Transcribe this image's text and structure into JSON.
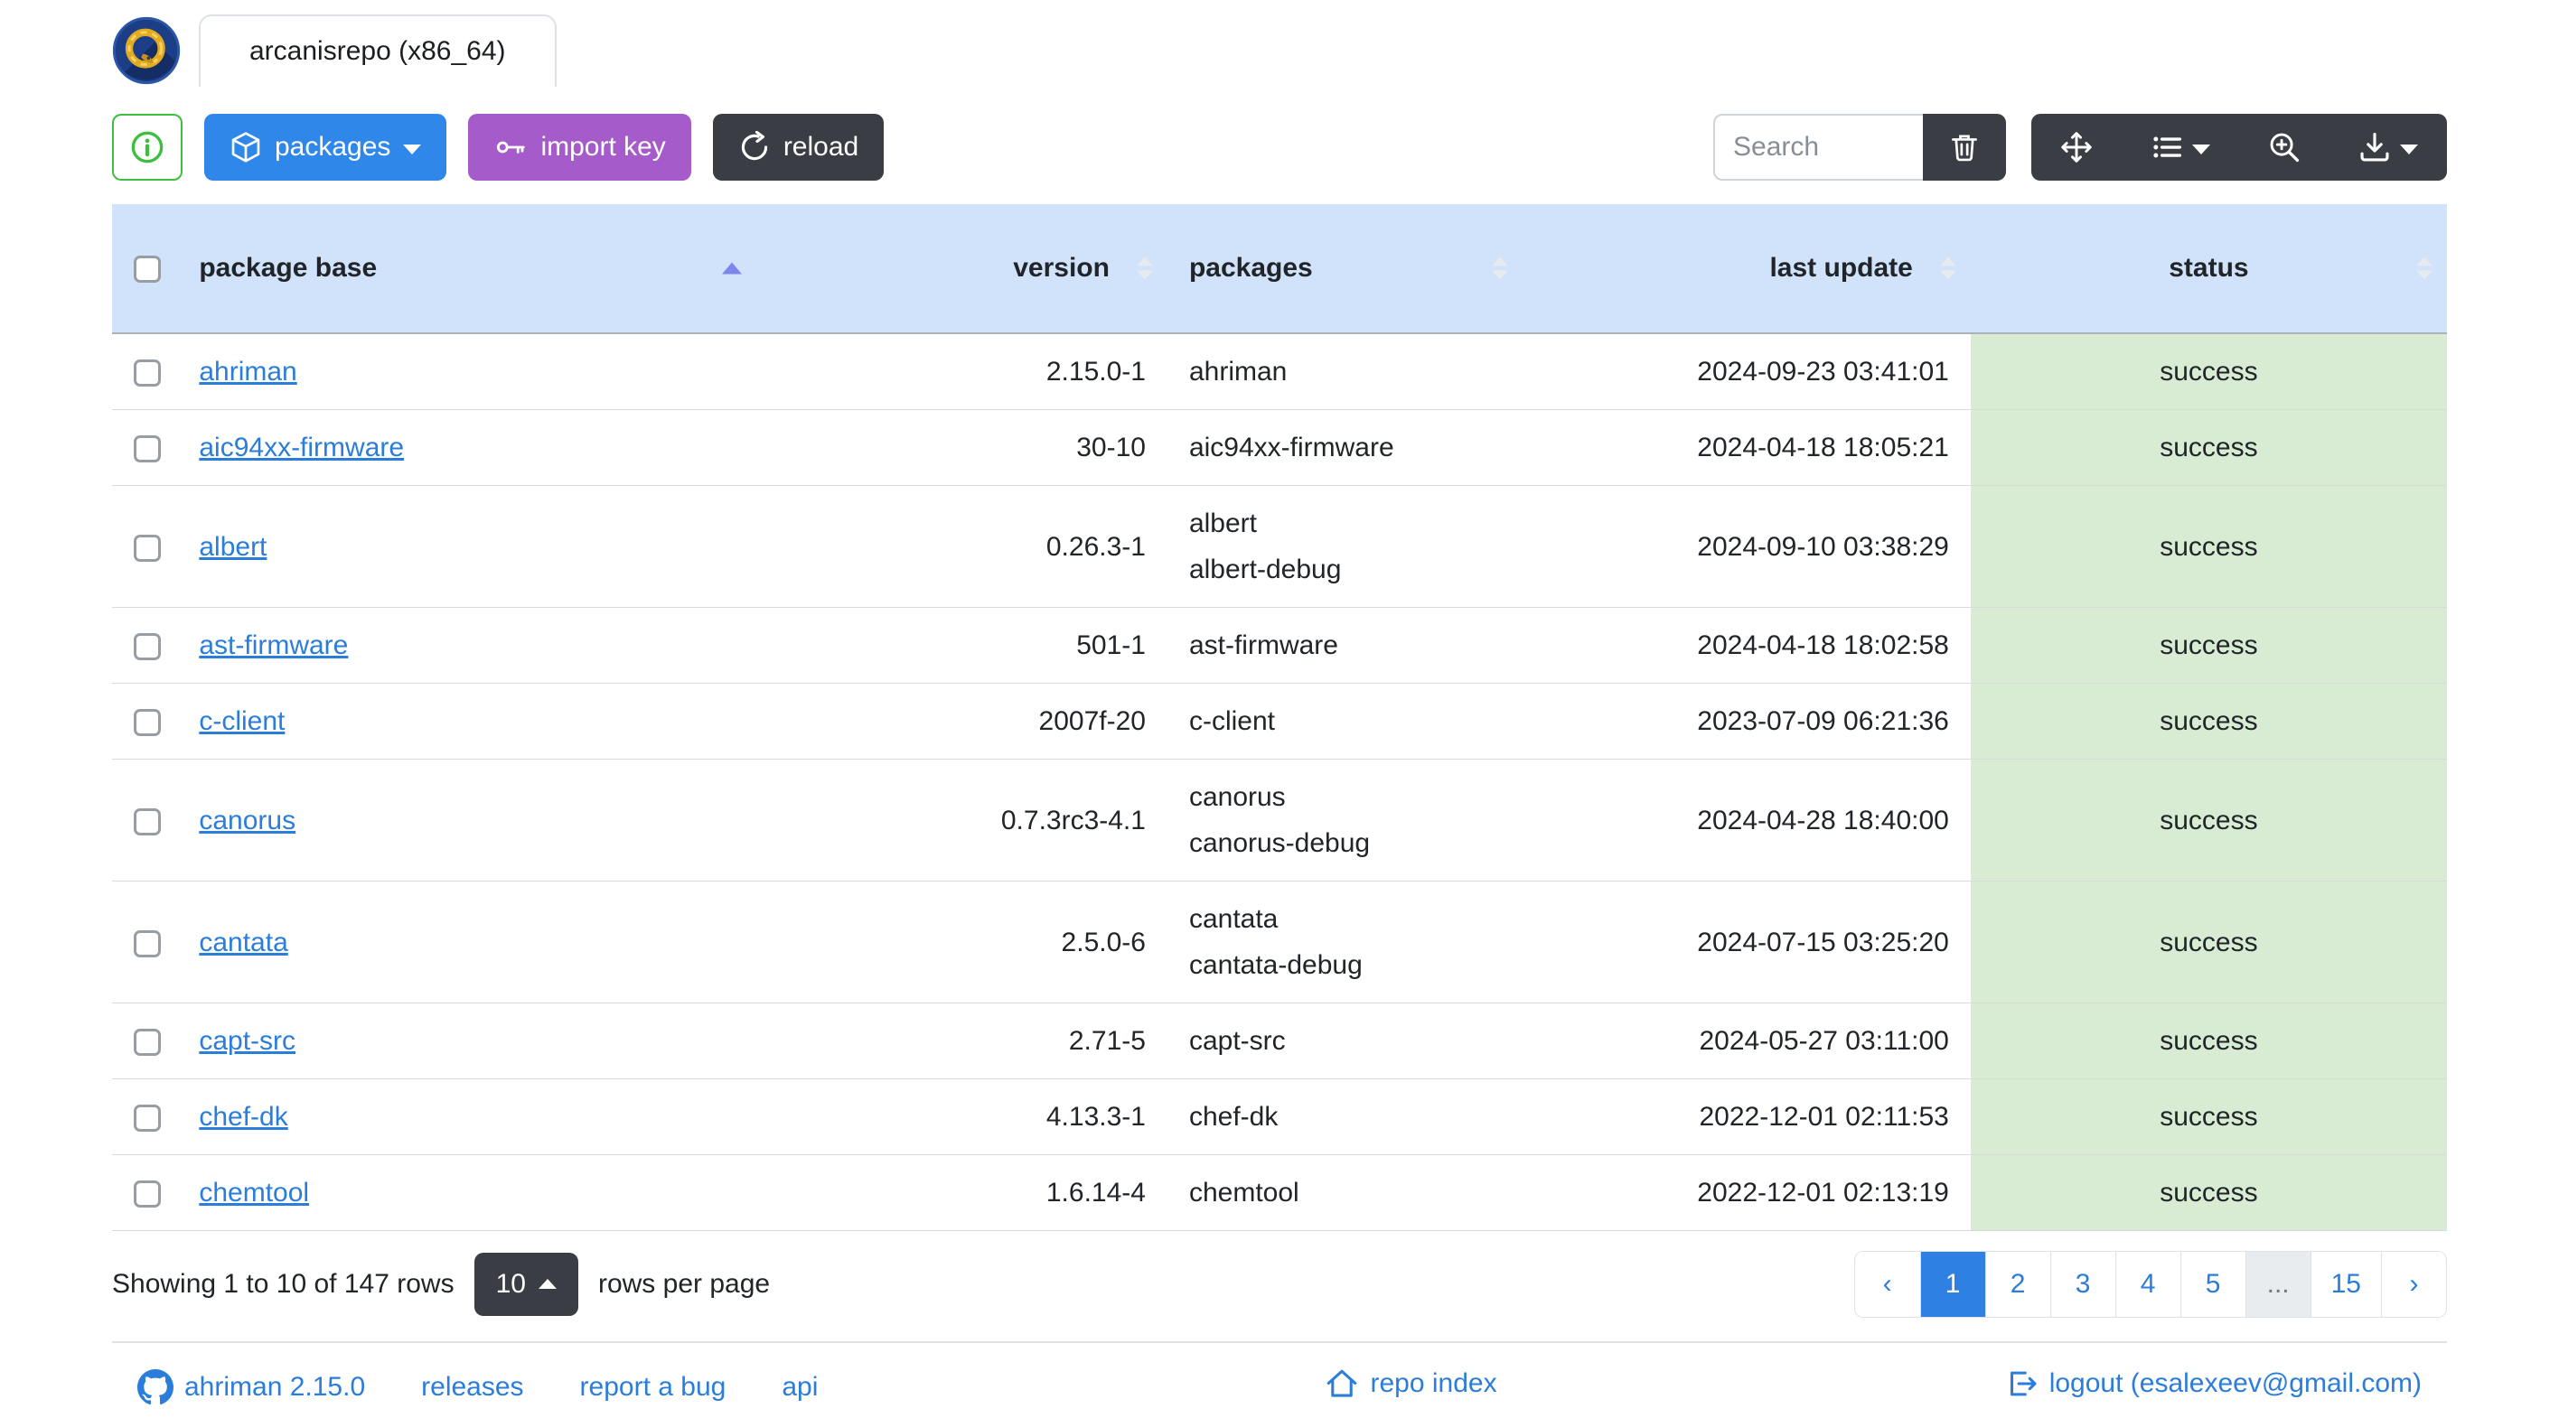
{
  "window": {
    "tab_label": "arcanisrepo (x86_64)"
  },
  "toolbar": {
    "packages_label": "packages",
    "import_key_label": "import key",
    "reload_label": "reload",
    "search_placeholder": "Search",
    "icons": {
      "info": "circle-info",
      "packages": "box",
      "import_key": "key",
      "reload": "arrow-clockwise",
      "delete": "trash",
      "fullscreen": "arrows-move",
      "columns": "list",
      "toggle_search": "zoom-in",
      "export": "download"
    }
  },
  "table": {
    "columns": [
      "package base",
      "version",
      "packages",
      "last update",
      "status"
    ],
    "sort": {
      "column": "package base",
      "direction": "asc"
    },
    "rows": [
      {
        "base": "ahriman",
        "version": "2.15.0-1",
        "packages": [
          "ahriman"
        ],
        "last_update": "2024-09-23 03:41:01",
        "status": "success"
      },
      {
        "base": "aic94xx-firmware",
        "version": "30-10",
        "packages": [
          "aic94xx-firmware"
        ],
        "last_update": "2024-04-18 18:05:21",
        "status": "success"
      },
      {
        "base": "albert",
        "version": "0.26.3-1",
        "packages": [
          "albert",
          "albert-debug"
        ],
        "last_update": "2024-09-10 03:38:29",
        "status": "success"
      },
      {
        "base": "ast-firmware",
        "version": "501-1",
        "packages": [
          "ast-firmware"
        ],
        "last_update": "2024-04-18 18:02:58",
        "status": "success"
      },
      {
        "base": "c-client",
        "version": "2007f-20",
        "packages": [
          "c-client"
        ],
        "last_update": "2023-07-09 06:21:36",
        "status": "success"
      },
      {
        "base": "canorus",
        "version": "0.7.3rc3-4.1",
        "packages": [
          "canorus",
          "canorus-debug"
        ],
        "last_update": "2024-04-28 18:40:00",
        "status": "success"
      },
      {
        "base": "cantata",
        "version": "2.5.0-6",
        "packages": [
          "cantata",
          "cantata-debug"
        ],
        "last_update": "2024-07-15 03:25:20",
        "status": "success"
      },
      {
        "base": "capt-src",
        "version": "2.71-5",
        "packages": [
          "capt-src"
        ],
        "last_update": "2024-05-27 03:11:00",
        "status": "success"
      },
      {
        "base": "chef-dk",
        "version": "4.13.3-1",
        "packages": [
          "chef-dk"
        ],
        "last_update": "2022-12-01 02:11:53",
        "status": "success"
      },
      {
        "base": "chemtool",
        "version": "1.6.14-4",
        "packages": [
          "chemtool"
        ],
        "last_update": "2022-12-01 02:13:19",
        "status": "success"
      }
    ]
  },
  "pagination": {
    "summary": "Showing 1 to 10 of 147 rows",
    "page_size": "10",
    "per_page_label": "rows per page",
    "items": [
      {
        "label": "‹",
        "kind": "prev"
      },
      {
        "label": "1",
        "kind": "page",
        "active": true
      },
      {
        "label": "2",
        "kind": "page"
      },
      {
        "label": "3",
        "kind": "page"
      },
      {
        "label": "4",
        "kind": "page"
      },
      {
        "label": "5",
        "kind": "page"
      },
      {
        "label": "...",
        "kind": "ellipsis"
      },
      {
        "label": "15",
        "kind": "page"
      },
      {
        "label": "›",
        "kind": "next"
      }
    ]
  },
  "footer": {
    "app_version": "ahriman 2.15.0",
    "releases": "releases",
    "report_bug": "report a bug",
    "api": "api",
    "repo_index": "repo index",
    "logout": "logout (esalexeev@gmail.com)",
    "icons": {
      "app": "github",
      "repo_index": "house",
      "logout": "box-arrow-right"
    }
  },
  "colors": {
    "primary_button": "#2e87e9",
    "purple_button": "#a55bc9",
    "dark_button": "#3a3e44",
    "info_green": "#3dbe3d",
    "header_bg": "#d1e3fa",
    "success_bg": "#d7ecd3",
    "link": "#2b7dda",
    "active_page": "#2e80e3",
    "sort_active": "#7c87e9"
  }
}
